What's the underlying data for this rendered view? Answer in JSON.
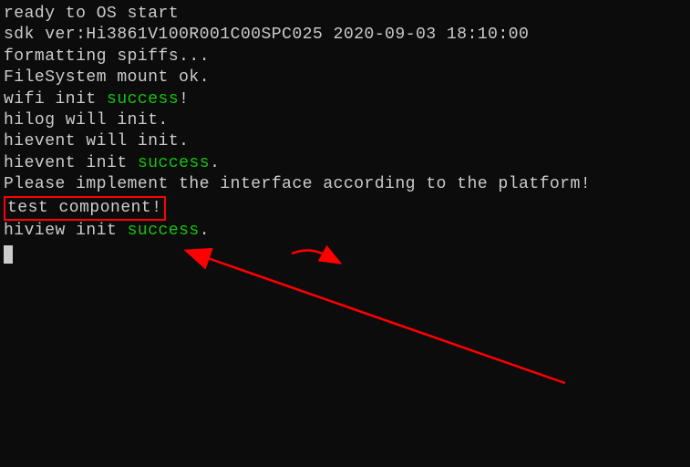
{
  "lines": {
    "l1": "ready to OS start",
    "l2": "sdk ver:Hi3861V100R001C00SPC025 2020-09-03 18:10:00",
    "l3": "formatting spiffs...",
    "l4": "FileSystem mount ok.",
    "l5a": "wifi init ",
    "l5b": "success",
    "l5c": "!",
    "l6": "hilog will init.",
    "l7": "",
    "l8": "hievent will init.",
    "l9": "",
    "l10a": "hievent init ",
    "l10b": "success",
    "l10c": ".",
    "l11": "Please implement the interface according to the platform!",
    "l12": "test component!",
    "l13a": "hiview init ",
    "l13b": "success",
    "l13c": "."
  },
  "annotations": {
    "highlight_color": "#ff0000",
    "arrow_color": "#ff0000"
  }
}
